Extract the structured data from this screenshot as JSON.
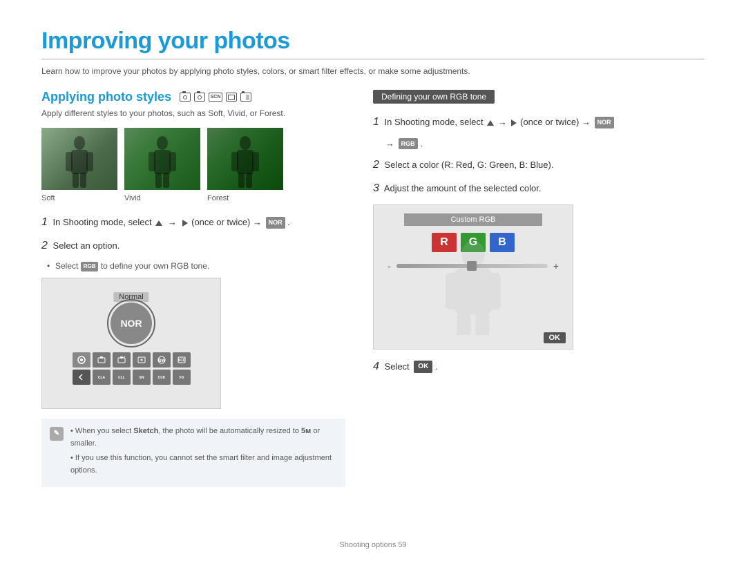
{
  "page": {
    "title": "Improving your photos",
    "subtitle": "Learn how to improve your photos by applying photo styles, colors, or smart filter effects, or make some adjustments.",
    "footer": "Shooting options  59"
  },
  "left_section": {
    "heading": "Applying photo styles",
    "description": "Apply different styles to your photos, such as Soft, Vivid, or Forest.",
    "photos": [
      {
        "label": "Soft"
      },
      {
        "label": "Vivid"
      },
      {
        "label": "Forest"
      }
    ],
    "steps": [
      {
        "num": "1",
        "text": "In Shooting mode, select"
      },
      {
        "num": "2",
        "text": "Select an option."
      }
    ],
    "bullet": "Select    to define your own RGB tone.",
    "normal_label": "Normal",
    "nor_text": "NOR"
  },
  "right_section": {
    "badge": "Defining your own RGB tone",
    "steps": [
      {
        "num": "1",
        "text": "In Shooting mode, select"
      },
      {
        "num": "2",
        "text": "Select a color (R: Red, G: Green, B: Blue)."
      },
      {
        "num": "3",
        "text": "Adjust the amount of the selected color."
      },
      {
        "num": "4",
        "text": "Select"
      }
    ],
    "rgb_ui": {
      "title": "Custom RGB",
      "r_label": "R",
      "g_label": "G",
      "b_label": "B",
      "minus": "-",
      "plus": "+",
      "ok": "OK"
    }
  },
  "note": {
    "bullets": [
      "When you select Sketch, the photo will be automatically resized to 5м or smaller.",
      "If you use this function, you cannot set the smart filter and image adjustment options."
    ]
  }
}
